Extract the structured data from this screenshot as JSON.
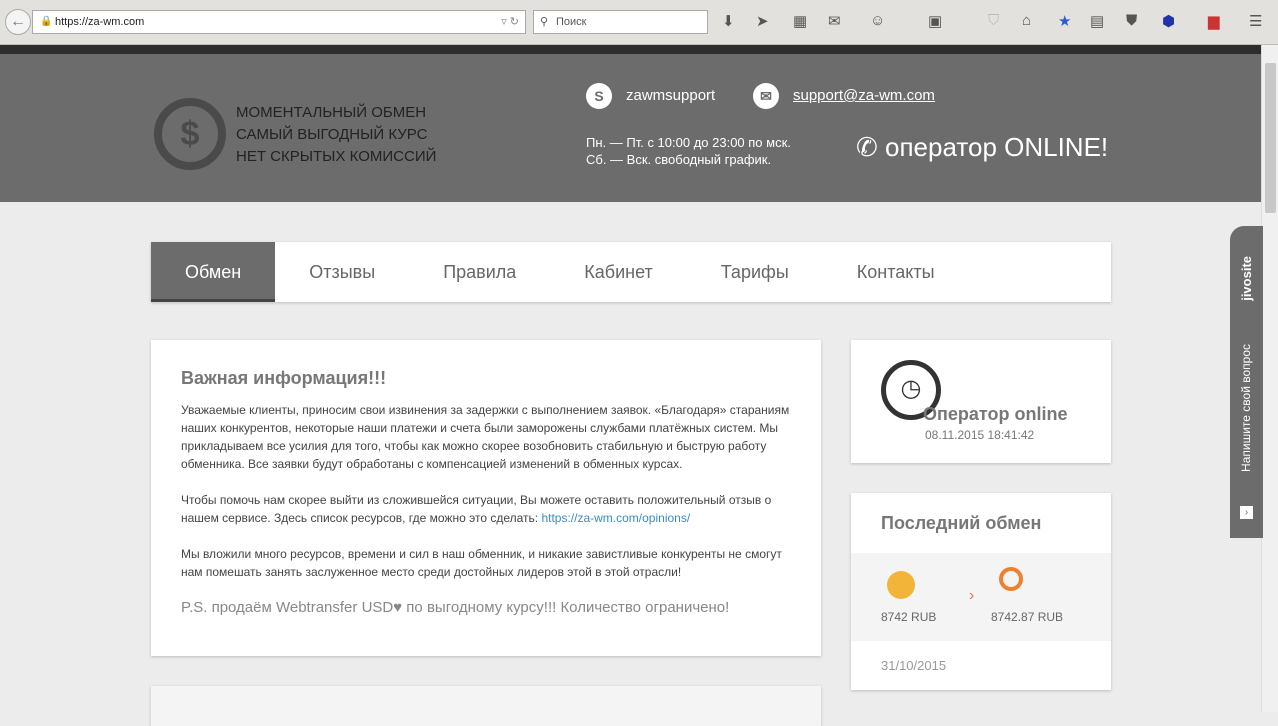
{
  "browser": {
    "url": "https://za-wm.com",
    "search_placeholder": "Поиск"
  },
  "header": {
    "slogans": [
      "МОМЕНТАЛЬНЫЙ ОБМЕН",
      "САМЫЙ ВЫГОДНЫЙ КУРС",
      "НЕТ СКРЫТЫХ КОМИССИЙ"
    ],
    "skype": "zawmsupport",
    "email": "support@za-wm.com",
    "hours": [
      "Пн. — Пт. с 10:00 до 23:00 по мск.",
      "Сб. — Вск. свободный график."
    ],
    "operator": "оператор ONLINE!"
  },
  "nav": [
    "Обмен",
    "Отзывы",
    "Правила",
    "Кабинет",
    "Тарифы",
    "Контакты"
  ],
  "info": {
    "title": "Важная информация!!!",
    "p1": "Уважаемые клиенты, приносим свои извинения за задержки с выполнением заявок. «Благодаря» стараниям наших конкурентов, некоторые наши платежи и счета были заморожены службами платёжных систем. Мы прикладываем все усилия для того, чтобы как можно скорее возобновить стабильную и быструю работу обменника. Все заявки будут обработаны с компенсацией изменений в обменных курсах.",
    "p2": "Чтобы помочь нам скорее выйти из сложившейся ситуации, Вы можете оставить положительный отзыв о нашем сервисе. Здесь список ресурсов, где можно это сделать: ",
    "link": "https://za-wm.com/opinions/",
    "p3": "Мы вложили много ресурсов, времени и сил в наш обменник, и никакие завистливые конкуренты не смогут нам помешать занять заслуженное место среди достойных лидеров этой в этой отрасли!",
    "ps": "P.S. продаём Webtransfer USD♥ по выгодному курсу!!! Количество ограничено!"
  },
  "operator_card": {
    "status": "Оператор online",
    "time": "08.11.2015 18:41:42"
  },
  "last_exchange": {
    "title": "Последний обмен",
    "from": "8742 RUB",
    "to": "8742.87 RUB",
    "date": "31/10/2015"
  },
  "jivo": {
    "brand": "jivosite",
    "cta": "Напишите свой вопрос"
  }
}
